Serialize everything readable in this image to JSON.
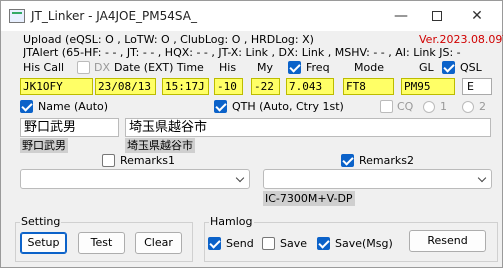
{
  "window": {
    "title": "JT_Linker - JA4JOE_PM54SA_",
    "minimize": "—",
    "close": "✕"
  },
  "status": {
    "upload": "Upload (eQSL: O , LoTW: O , ClubLog: O , HRDLog: X)",
    "version": "Ver.2023.08.09T",
    "jtalert": "JTAlert (65-HF: - - , JT: - - , HQX: - - , JT-X: Link , DX: Link , MSHV: - - , AI: Link  JS: -"
  },
  "columns": {
    "his_call": "His Call",
    "dx": "DX",
    "date": "Date (EXT) Time",
    "his": "His",
    "my": "My",
    "freq": "Freq",
    "mode": "Mode",
    "gl": "GL",
    "qsl": "QSL"
  },
  "values": {
    "his_call": "JK1OFY",
    "date": "23/08/13",
    "time": "15:17J",
    "his": "-10",
    "my": "-22",
    "freq": "7.043",
    "mode": "FT8",
    "gl": "PM95",
    "qsl": "E"
  },
  "name": {
    "label": "Name (Auto)",
    "value": "野口武男",
    "display": "野口武男"
  },
  "qth": {
    "label": "QTH (Auto, Ctry 1st)",
    "value": "埼玉県越谷市",
    "display": "埼玉県越谷市",
    "cq": "CQ",
    "radio1": "1",
    "radio2": "2"
  },
  "remarks": {
    "remarks1": "Remarks1",
    "remarks2": "Remarks2",
    "remarks2_display": "IC-7300M+V-DP"
  },
  "setting": {
    "title": "Setting",
    "setup": "Setup",
    "test": "Test",
    "clear": "Clear"
  },
  "hamlog": {
    "title": "Hamlog",
    "send": "Send",
    "save": "Save",
    "save_msg": "Save(Msg)",
    "resend": "Resend"
  }
}
